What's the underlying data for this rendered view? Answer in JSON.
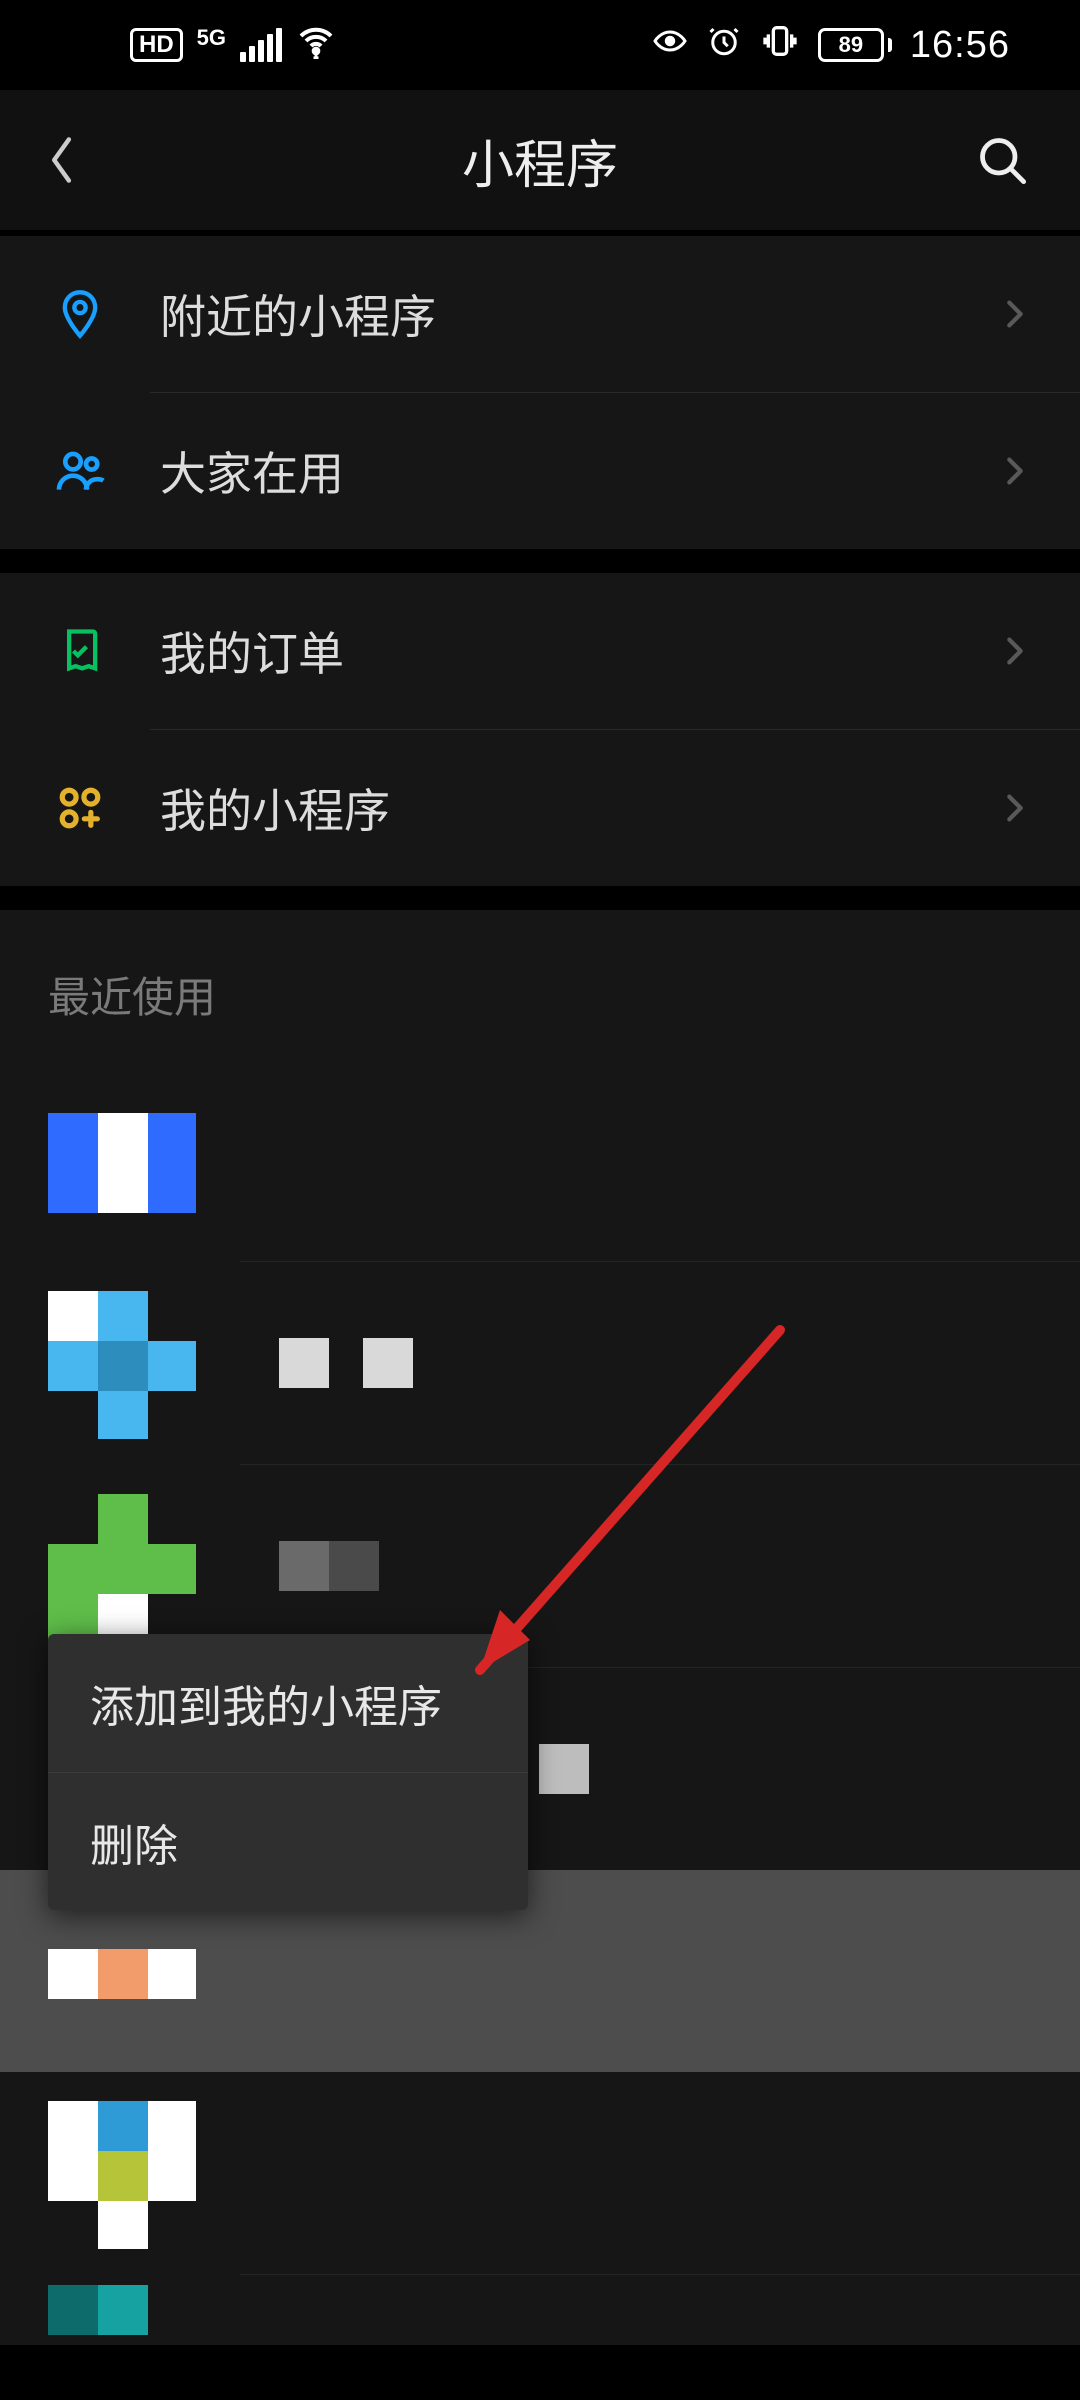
{
  "status": {
    "hd": "HD",
    "net": "5G",
    "battery": "89",
    "time": "16:56"
  },
  "nav": {
    "title": "小程序"
  },
  "rows": {
    "nearby": "附近的小程序",
    "popular": "大家在用",
    "orders": "我的订单",
    "mine": "我的小程序"
  },
  "recent": {
    "header": "最近使用"
  },
  "context_menu": {
    "add": "添加到我的小程序",
    "delete": "删除"
  },
  "colors": {
    "accent_blue": "#19a0ff",
    "accent_green": "#07c160",
    "accent_amber": "#e3b12b",
    "annotation_red": "#d62626"
  }
}
